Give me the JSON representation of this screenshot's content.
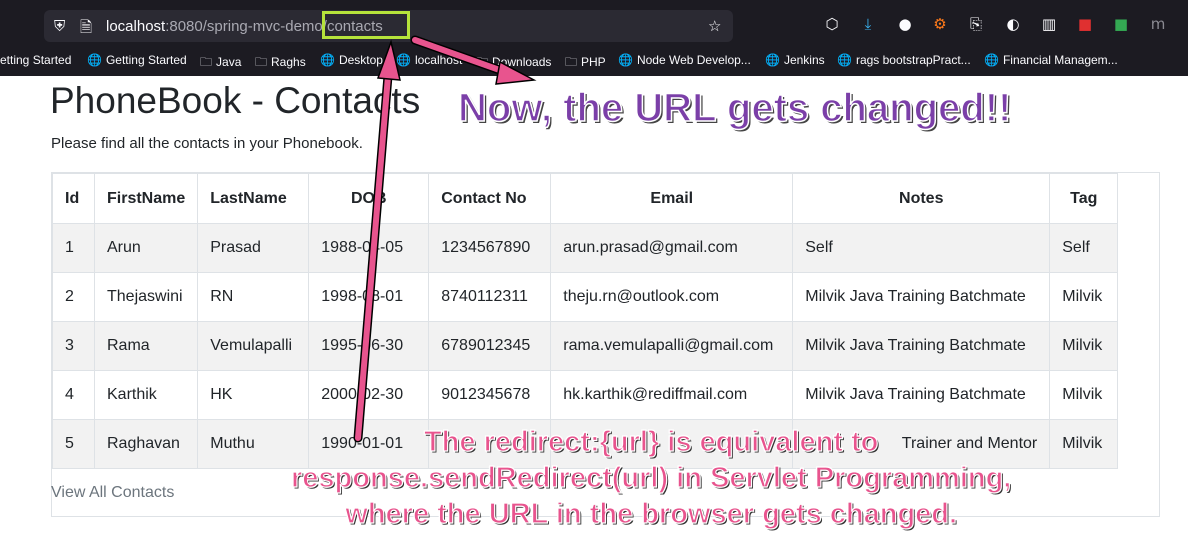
{
  "browser": {
    "url_host": "localhost",
    "url_rest": ":8080/spring-mvc-demo/",
    "url_path": "contacts",
    "bookmarks": [
      "etting Started",
      "Getting Started",
      "Java",
      "Raghs",
      "Desktop",
      "localhost",
      "Downloads",
      "PHP",
      "Node Web Develop...",
      "Jenkins",
      "rags bootstrapPract...",
      "Financial Managem..."
    ]
  },
  "page": {
    "title": "PhoneBook - Contacts",
    "subtitle": "Please find all the contacts in your Phonebook.",
    "view_all": "View All Contacts"
  },
  "table": {
    "headers": [
      "Id",
      "FirstName",
      "LastName",
      "DOB",
      "Contact No",
      "Email",
      "Notes",
      "Tag"
    ],
    "rows": [
      [
        "1",
        "Arun",
        "Prasad",
        "1988-04-05",
        "1234567890",
        "arun.prasad@gmail.com",
        "Self",
        "Self"
      ],
      [
        "2",
        "Thejaswini",
        "RN",
        "1998-08-01",
        "8740112311",
        "theju.rn@outlook.com",
        "Milvik Java Training Batchmate",
        "Milvik"
      ],
      [
        "3",
        "Rama",
        "Vemulapalli",
        "1995-06-30",
        "6789012345",
        "rama.vemulapalli@gmail.com",
        "Milvik Java Training Batchmate",
        "Milvik"
      ],
      [
        "4",
        "Karthik",
        "HK",
        "2000-02-30",
        "9012345678",
        "hk.karthik@rediffmail.com",
        "Milvik Java Training Batchmate",
        "Milvik"
      ],
      [
        "5",
        "Raghavan",
        "Muthu",
        "1990-01-01",
        "",
        "",
        "Trainer and Mentor",
        "Milvik"
      ]
    ]
  },
  "annotations": {
    "top": "Now, the URL gets changed!!",
    "bottom_line1": "The redirect:{url} is equivalent to",
    "bottom_line2": "response.sendRedirect(url) in Servlet Programming,",
    "bottom_line3": "where the URL in the browser gets changed."
  },
  "colors": {
    "highlight_box": "#b6e33b",
    "arrow": "#e8548e",
    "callout_top": "#7b3fa8",
    "callout_bottom": "#e8548e"
  }
}
